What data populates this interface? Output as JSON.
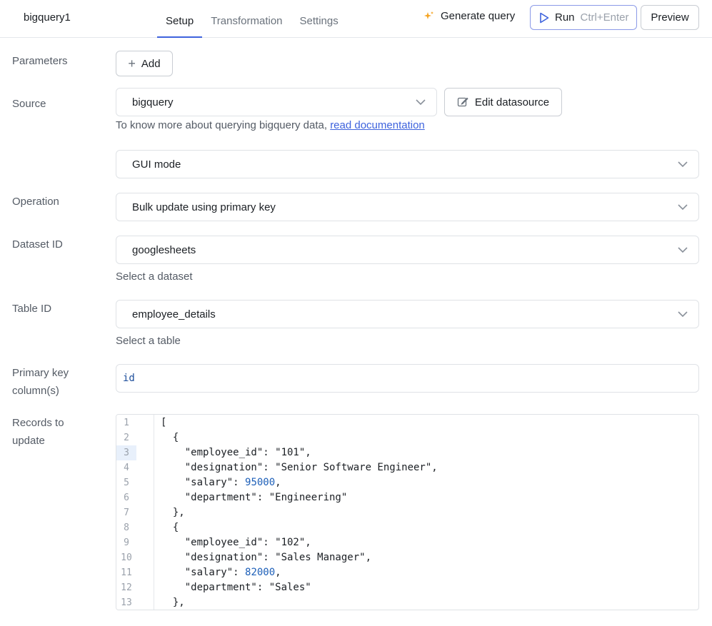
{
  "header": {
    "query_name": "bigquery1",
    "tabs": [
      {
        "label": "Setup",
        "active": true
      },
      {
        "label": "Transformation",
        "active": false
      },
      {
        "label": "Settings",
        "active": false
      }
    ],
    "generate_query": "Generate query",
    "run_label": "Run",
    "run_shortcut": "Ctrl+Enter",
    "preview_label": "Preview"
  },
  "form": {
    "parameters_label": "Parameters",
    "add_label": "Add",
    "source_label": "Source",
    "source_value": "bigquery",
    "edit_datasource_label": "Edit datasource",
    "source_help": "To know more about querying bigquery data, ",
    "source_help_link": "read documentation",
    "mode_value": "GUI mode",
    "operation_label": "Operation",
    "operation_value": "Bulk update using primary key",
    "dataset_label": "Dataset ID",
    "dataset_value": "googlesheets",
    "dataset_help": "Select a dataset",
    "table_label": "Table ID",
    "table_value": "employee_details",
    "table_help": "Select a table",
    "primary_key_label_1": "Primary key",
    "primary_key_label_2": "column(s)",
    "primary_key_value": "id",
    "records_label_1": "Records to",
    "records_label_2": "update"
  },
  "editor": {
    "active_line": 3,
    "lines": [
      "[",
      "  {",
      "    \"employee_id\": \"101\",",
      "    \"designation\": \"Senior Software Engineer\",",
      "    \"salary\": 95000,",
      "    \"department\": \"Engineering\"",
      "  },",
      "  {",
      "    \"employee_id\": \"102\",",
      "    \"designation\": \"Sales Manager\",",
      "    \"salary\": 82000,",
      "    \"department\": \"Sales\"",
      "  },"
    ]
  },
  "colors": {
    "accent": "#3e63dd",
    "run_border": "#8b9ae8",
    "number": "#1d5fb8",
    "spark": "#f5a524"
  }
}
